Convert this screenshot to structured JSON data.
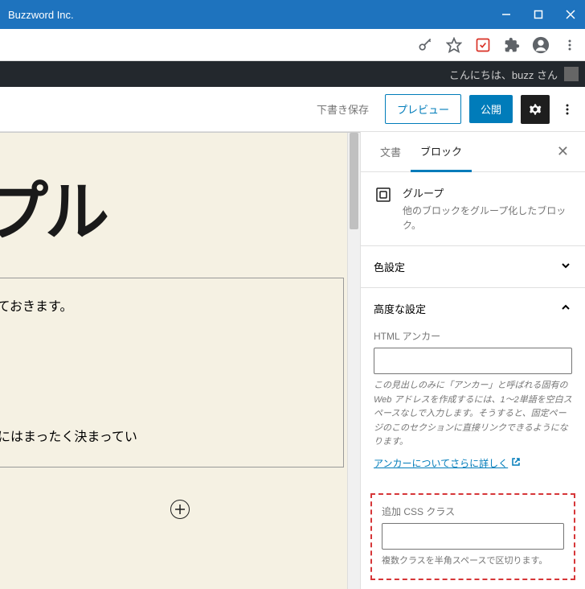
{
  "window": {
    "title": "Buzzword Inc."
  },
  "admin_bar": {
    "greeting": "こんにちは、buzz さん"
  },
  "toolbar": {
    "save_draft": "下書き保存",
    "preview": "プレビュー",
    "publish": "公開"
  },
  "editor": {
    "heading_fragment": "プル",
    "text1": "いておきます。",
    "text2": "りにはまったく決まってい"
  },
  "sidebar": {
    "tabs": {
      "document": "文書",
      "block": "ブロック"
    },
    "block_info": {
      "title": "グループ",
      "description": "他のブロックをグループ化したブロック。"
    },
    "color_panel": {
      "title": "色設定"
    },
    "advanced_panel": {
      "title": "高度な設定",
      "anchor_label": "HTML アンカー",
      "anchor_help": "この見出しのみに「アンカー」と呼ばれる固有の Web アドレスを作成するには、1～2単語を空白スペースなしで入力します。そうすると、固定ページのこのセクションに直接リンクできるようになります。",
      "anchor_link": "アンカーについてさらに詳しく",
      "css_label": "追加 CSS クラス",
      "css_help": "複数クラスを半角スペースで区切ります。"
    }
  }
}
